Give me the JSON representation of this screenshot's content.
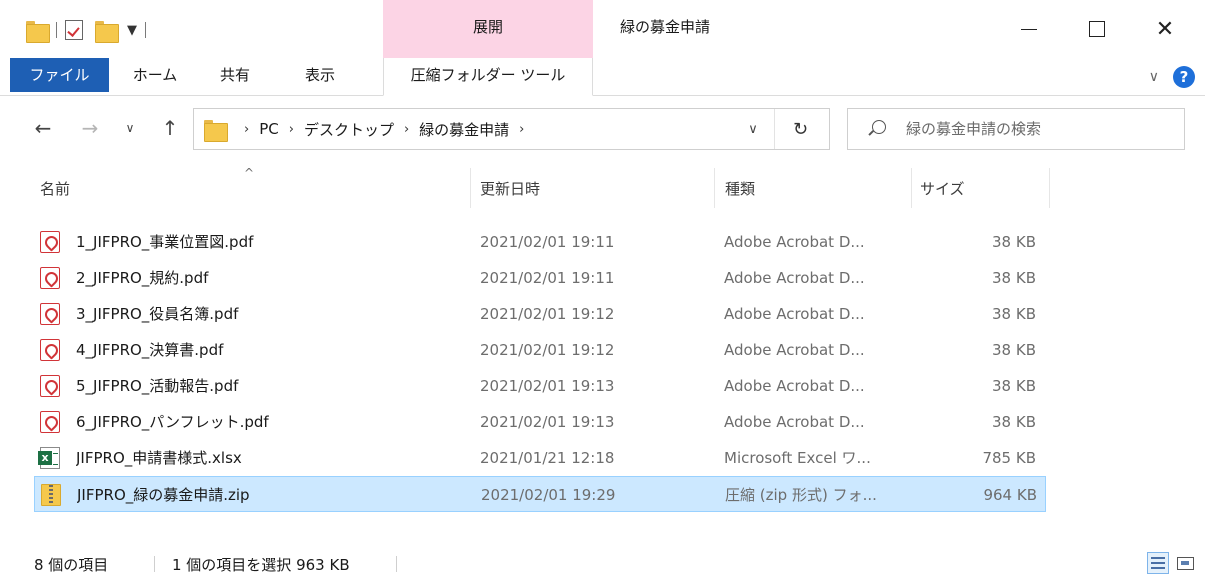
{
  "window": {
    "title": "緑の募金申請",
    "context_group": "展開"
  },
  "ribbon": {
    "tabs": [
      "ファイル",
      "ホーム",
      "共有",
      "表示",
      "圧縮フォルダー ツール"
    ]
  },
  "address": {
    "crumbs": [
      "PC",
      "デスクトップ",
      "緑の募金申請"
    ]
  },
  "search": {
    "placeholder": "緑の募金申請の検索"
  },
  "columns": {
    "name": "名前",
    "date": "更新日時",
    "type": "種類",
    "size": "サイズ"
  },
  "files": [
    {
      "name": "1_JIFPRO_事業位置図.pdf",
      "date": "2021/02/01 19:11",
      "type": "Adobe Acrobat D...",
      "size": "38 KB",
      "icon": "pdf-icon"
    },
    {
      "name": "2_JIFPRO_規約.pdf",
      "date": "2021/02/01 19:11",
      "type": "Adobe Acrobat D...",
      "size": "38 KB",
      "icon": "pdf-icon"
    },
    {
      "name": "3_JIFPRO_役員名簿.pdf",
      "date": "2021/02/01 19:12",
      "type": "Adobe Acrobat D...",
      "size": "38 KB",
      "icon": "pdf-icon"
    },
    {
      "name": "4_JIFPRO_決算書.pdf",
      "date": "2021/02/01 19:12",
      "type": "Adobe Acrobat D...",
      "size": "38 KB",
      "icon": "pdf-icon"
    },
    {
      "name": "5_JIFPRO_活動報告.pdf",
      "date": "2021/02/01 19:13",
      "type": "Adobe Acrobat D...",
      "size": "38 KB",
      "icon": "pdf-icon"
    },
    {
      "name": "6_JIFPRO_パンフレット.pdf",
      "date": "2021/02/01 19:13",
      "type": "Adobe Acrobat D...",
      "size": "38 KB",
      "icon": "pdf-icon"
    },
    {
      "name": "JIFPRO_申請書様式.xlsx",
      "date": "2021/01/21 12:18",
      "type": "Microsoft Excel ワ...",
      "size": "785 KB",
      "icon": "excel-icon"
    },
    {
      "name": "JIFPRO_緑の募金申請.zip",
      "date": "2021/02/01 19:29",
      "type": "圧縮 (zip 形式) フォ...",
      "size": "964 KB",
      "icon": "zip-folder-icon",
      "selected": true
    }
  ],
  "status": {
    "item_count": "8 個の項目",
    "selection": "1 個の項目を選択  963 KB"
  },
  "colors": {
    "file_tab": "#1e5fb4",
    "context_group": "#fcd4e5",
    "selection": "#cce8ff",
    "selection_border": "#99d1ff"
  }
}
